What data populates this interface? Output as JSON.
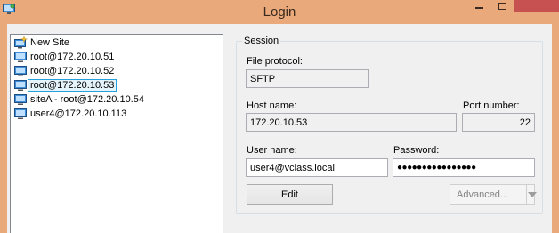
{
  "window": {
    "title": "Login"
  },
  "sites": [
    {
      "label": "New Site",
      "icon": "new-site-icon"
    },
    {
      "label": "root@172.20.10.51",
      "icon": "monitor-icon"
    },
    {
      "label": "root@172.20.10.52",
      "icon": "monitor-icon"
    },
    {
      "label": "root@172.20.10.53",
      "icon": "monitor-icon",
      "selected": true
    },
    {
      "label": "siteA - root@172.20.10.54",
      "icon": "monitor-icon"
    },
    {
      "label": "user4@172.20.10.113",
      "icon": "monitor-icon"
    }
  ],
  "session": {
    "group_label": "Session",
    "file_protocol_label": "File protocol:",
    "file_protocol_value": "SFTP",
    "host_name_label": "Host name:",
    "host_name_value": "172.20.10.53",
    "port_number_label": "Port number:",
    "port_number_value": "22",
    "user_name_label": "User name:",
    "user_name_value": "user4@vclass.local",
    "password_label": "Password:",
    "password_value": "●●●●●●●●●●●●●●●●",
    "edit_label": "Edit",
    "advanced_label": "Advanced..."
  },
  "colors": {
    "titlebar": "#e9a97a",
    "close_button": "#c75050",
    "selection": "#26a0da"
  }
}
